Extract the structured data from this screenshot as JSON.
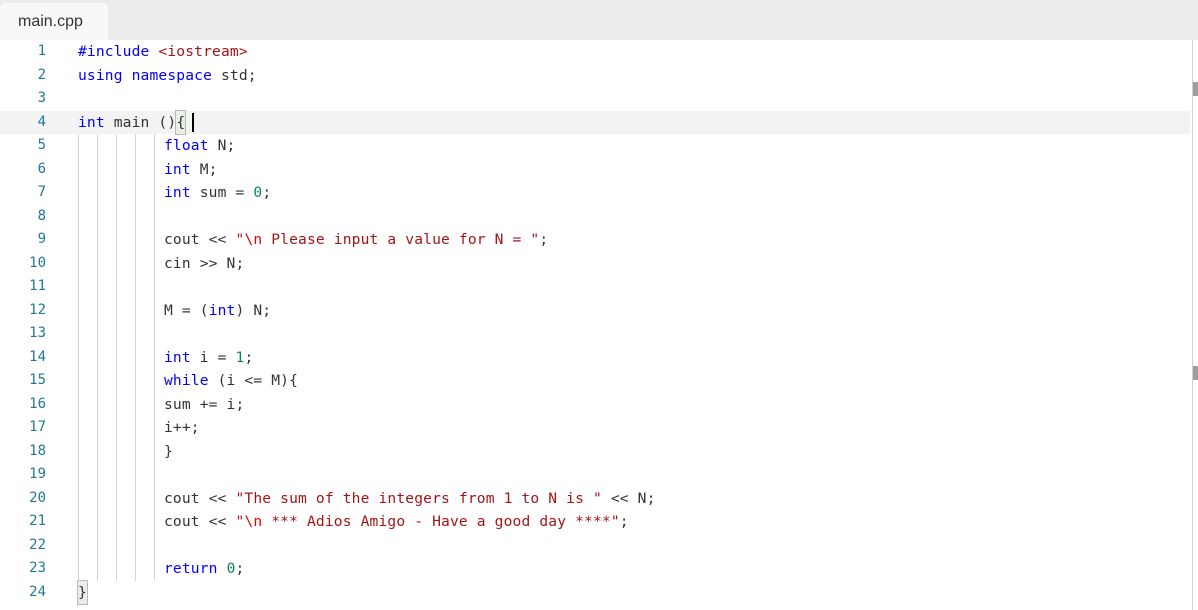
{
  "tab": {
    "title": "main.cpp"
  },
  "editor": {
    "current_line": 4,
    "lines": [
      {
        "n": "1",
        "indent": false,
        "tokens": [
          [
            "kw",
            "#include "
          ],
          [
            "str",
            "<iostream>"
          ]
        ]
      },
      {
        "n": "2",
        "indent": false,
        "tokens": [
          [
            "kw",
            "using namespace "
          ],
          [
            "",
            "std;"
          ]
        ]
      },
      {
        "n": "3",
        "indent": false,
        "tokens": []
      },
      {
        "n": "4",
        "indent": false,
        "tokens": [
          [
            "kw",
            "int "
          ],
          [
            "",
            "main ()"
          ],
          [
            "bracket",
            "{"
          ]
        ]
      },
      {
        "n": "5",
        "indent": true,
        "tokens": [
          [
            "kw",
            "float "
          ],
          [
            "",
            "N;"
          ]
        ]
      },
      {
        "n": "6",
        "indent": true,
        "tokens": [
          [
            "kw",
            "int "
          ],
          [
            "",
            "M;"
          ]
        ]
      },
      {
        "n": "7",
        "indent": true,
        "tokens": [
          [
            "kw",
            "int "
          ],
          [
            "",
            "sum = "
          ],
          [
            "num",
            "0"
          ],
          [
            "",
            ";"
          ]
        ]
      },
      {
        "n": "8",
        "indent": true,
        "tokens": []
      },
      {
        "n": "9",
        "indent": true,
        "tokens": [
          [
            "",
            "cout << "
          ],
          [
            "str",
            "\""
          ],
          [
            "esc",
            "\\n"
          ],
          [
            "str",
            " Please input a value for N = \""
          ],
          [
            "",
            ";"
          ]
        ]
      },
      {
        "n": "10",
        "indent": true,
        "tokens": [
          [
            "",
            "cin >> N;"
          ]
        ]
      },
      {
        "n": "11",
        "indent": true,
        "tokens": []
      },
      {
        "n": "12",
        "indent": true,
        "tokens": [
          [
            "",
            "M = ("
          ],
          [
            "kw",
            "int"
          ],
          [
            "",
            ") N;"
          ]
        ]
      },
      {
        "n": "13",
        "indent": true,
        "tokens": []
      },
      {
        "n": "14",
        "indent": true,
        "tokens": [
          [
            "kw",
            "int "
          ],
          [
            "",
            "i = "
          ],
          [
            "num",
            "1"
          ],
          [
            "",
            ";"
          ]
        ]
      },
      {
        "n": "15",
        "indent": true,
        "tokens": [
          [
            "kw",
            "while "
          ],
          [
            "",
            "(i <= M){"
          ]
        ]
      },
      {
        "n": "16",
        "indent": true,
        "tokens": [
          [
            "",
            "sum += i;"
          ]
        ]
      },
      {
        "n": "17",
        "indent": true,
        "tokens": [
          [
            "",
            "i++;"
          ]
        ]
      },
      {
        "n": "18",
        "indent": true,
        "tokens": [
          [
            "",
            "}"
          ]
        ]
      },
      {
        "n": "19",
        "indent": true,
        "tokens": []
      },
      {
        "n": "20",
        "indent": true,
        "tokens": [
          [
            "",
            "cout << "
          ],
          [
            "str",
            "\"The sum of the integers from 1 to N is \""
          ],
          [
            "",
            " << N;"
          ]
        ]
      },
      {
        "n": "21",
        "indent": true,
        "tokens": [
          [
            "",
            "cout << "
          ],
          [
            "str",
            "\""
          ],
          [
            "esc",
            "\\n"
          ],
          [
            "str",
            " *** Adios Amigo - Have a good day ****\""
          ],
          [
            "",
            ";"
          ]
        ]
      },
      {
        "n": "22",
        "indent": true,
        "tokens": []
      },
      {
        "n": "23",
        "indent": true,
        "tokens": [
          [
            "kw",
            "return "
          ],
          [
            "num",
            "0"
          ],
          [
            "",
            ";"
          ]
        ]
      },
      {
        "n": "24",
        "indent": false,
        "tokens": [
          [
            "bracket",
            "}"
          ]
        ]
      }
    ]
  },
  "colors": {
    "keyword": "#0000ff",
    "string": "#a31515",
    "escape": "#ee0000",
    "number": "#098658",
    "line_number": "#237893"
  }
}
